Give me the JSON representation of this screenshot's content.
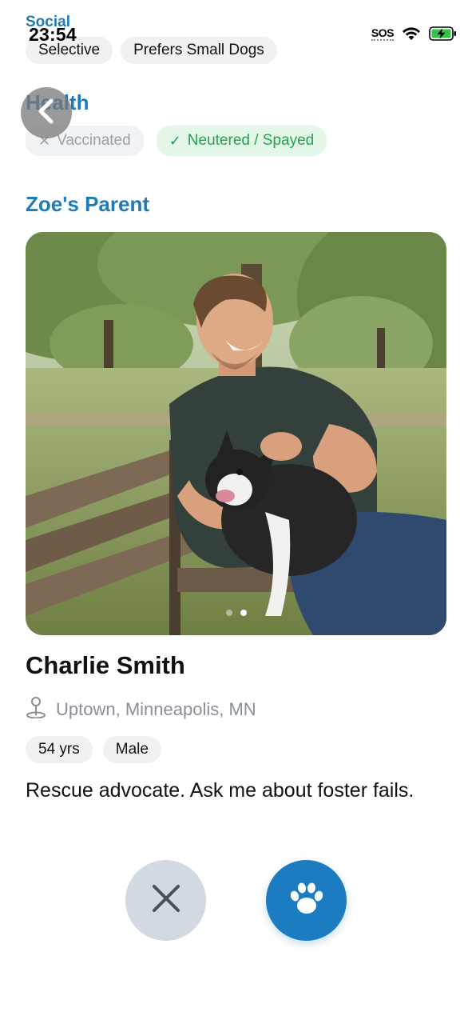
{
  "status_bar": {
    "time": "23:54",
    "sos": "SOS",
    "icons": [
      "wifi-icon",
      "battery-charging-icon"
    ]
  },
  "social": {
    "title": "Social",
    "chips": [
      "Selective",
      "Prefers Small Dogs"
    ]
  },
  "health": {
    "title": "Health",
    "chips": [
      {
        "label": "Vaccinated",
        "mark": "✕",
        "state": "no"
      },
      {
        "label": "Neutered / Spayed",
        "mark": "✓",
        "state": "yes"
      }
    ]
  },
  "parent_section": {
    "title": "Zoe's Parent"
  },
  "profile": {
    "photo_icon": "person-with-dog-photo",
    "photo_count": 2,
    "photo_active_index": 1,
    "name": "Charlie Smith",
    "location": "Uptown, Minneapolis, MN",
    "tags": [
      "54 yrs",
      "Male"
    ],
    "bio": "Rescue advocate. Ask me about foster fails."
  },
  "actions": {
    "pass_icon": "close-icon",
    "like_icon": "paw-icon"
  },
  "colors": {
    "accent": "#1e7ab8",
    "like_button": "#1c7cc2",
    "pass_button": "#d3d9e0",
    "positive": "#22a352",
    "muted": "#8a8f96"
  }
}
